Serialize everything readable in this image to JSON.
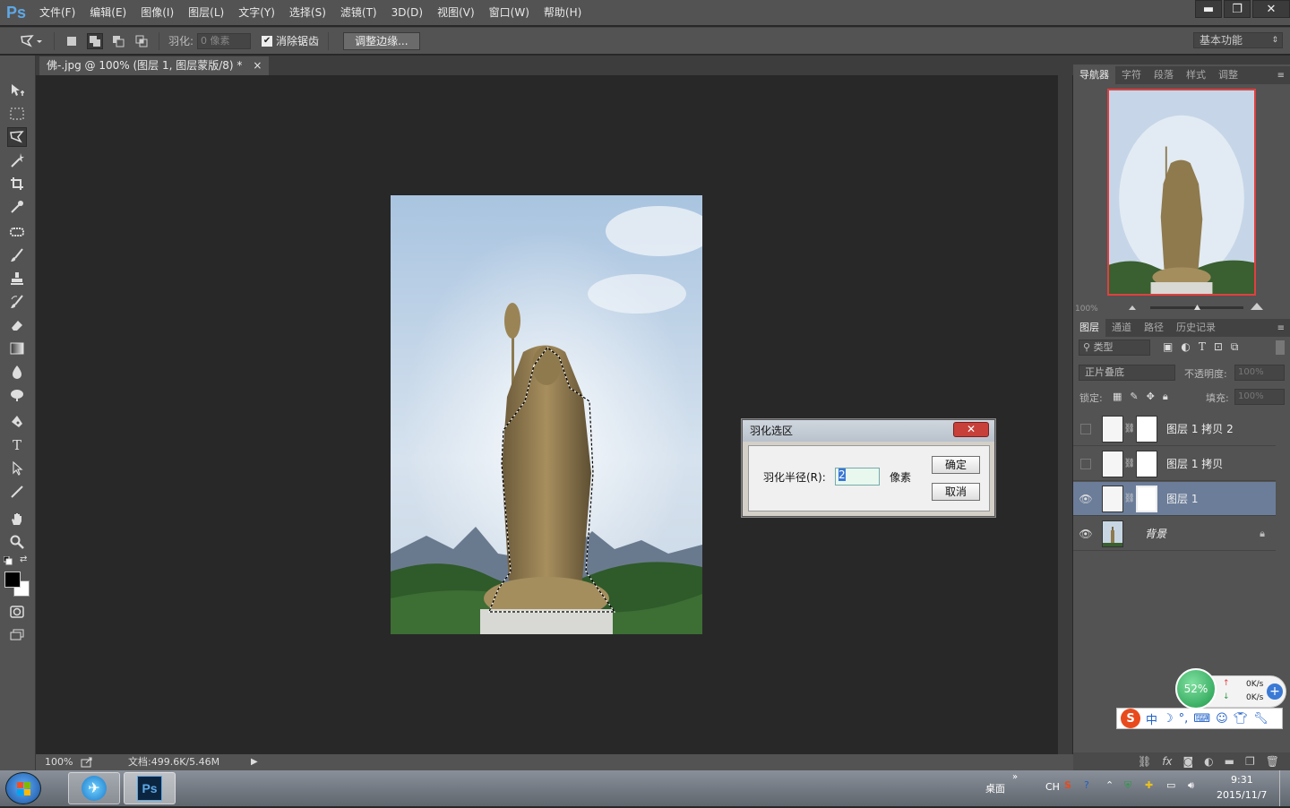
{
  "app": {
    "logo": "Ps"
  },
  "menu": [
    "文件(F)",
    "编辑(E)",
    "图像(I)",
    "图层(L)",
    "文字(Y)",
    "选择(S)",
    "滤镜(T)",
    "3D(D)",
    "视图(V)",
    "窗口(W)",
    "帮助(H)"
  ],
  "window_buttons": {
    "minimize": "▬",
    "restore": "❐",
    "close": "✕"
  },
  "options": {
    "feather_label": "羽化:",
    "feather_value": "0 像素",
    "antialias_label": "消除锯齿",
    "refine_button": "调整边缘...",
    "workspace": "基本功能"
  },
  "document": {
    "tab_title": "佛-.jpg @ 100% (图层 1, 图层蒙版/8) *",
    "tab_close": "×"
  },
  "status": {
    "zoom": "100%",
    "doc_info": "文档:499.6K/5.46M"
  },
  "dialog": {
    "title": "羽化选区",
    "close": "✕",
    "radius_label": "羽化半径(R):",
    "radius_value": "2",
    "unit": "像素",
    "ok": "确定",
    "cancel": "取消"
  },
  "panels": {
    "top_tabs": [
      "导航器",
      "字符",
      "段落",
      "样式",
      "调整"
    ],
    "nav_zoom": "100%",
    "layer_tabs": [
      "图层",
      "通道",
      "路径",
      "历史记录"
    ],
    "filter_type": "类型",
    "blend_mode": "正片叠底",
    "opacity_label": "不透明度:",
    "opacity_value": "100%",
    "lock_label": "锁定:",
    "fill_label": "填充:",
    "fill_value": "100%"
  },
  "layers": [
    {
      "name": "图层 1 拷贝 2",
      "visible": false,
      "selected": false
    },
    {
      "name": "图层 1 拷贝",
      "visible": false,
      "selected": false
    },
    {
      "name": "图层 1",
      "visible": true,
      "selected": true
    },
    {
      "name": "背景",
      "visible": true,
      "selected": false
    }
  ],
  "widget": {
    "cpu": "52%",
    "up": "0K/s",
    "down": "0K/s"
  },
  "taskbar": {
    "desktop": "桌面",
    "lang": "CH",
    "time": "9:31",
    "date": "2015/11/7"
  }
}
